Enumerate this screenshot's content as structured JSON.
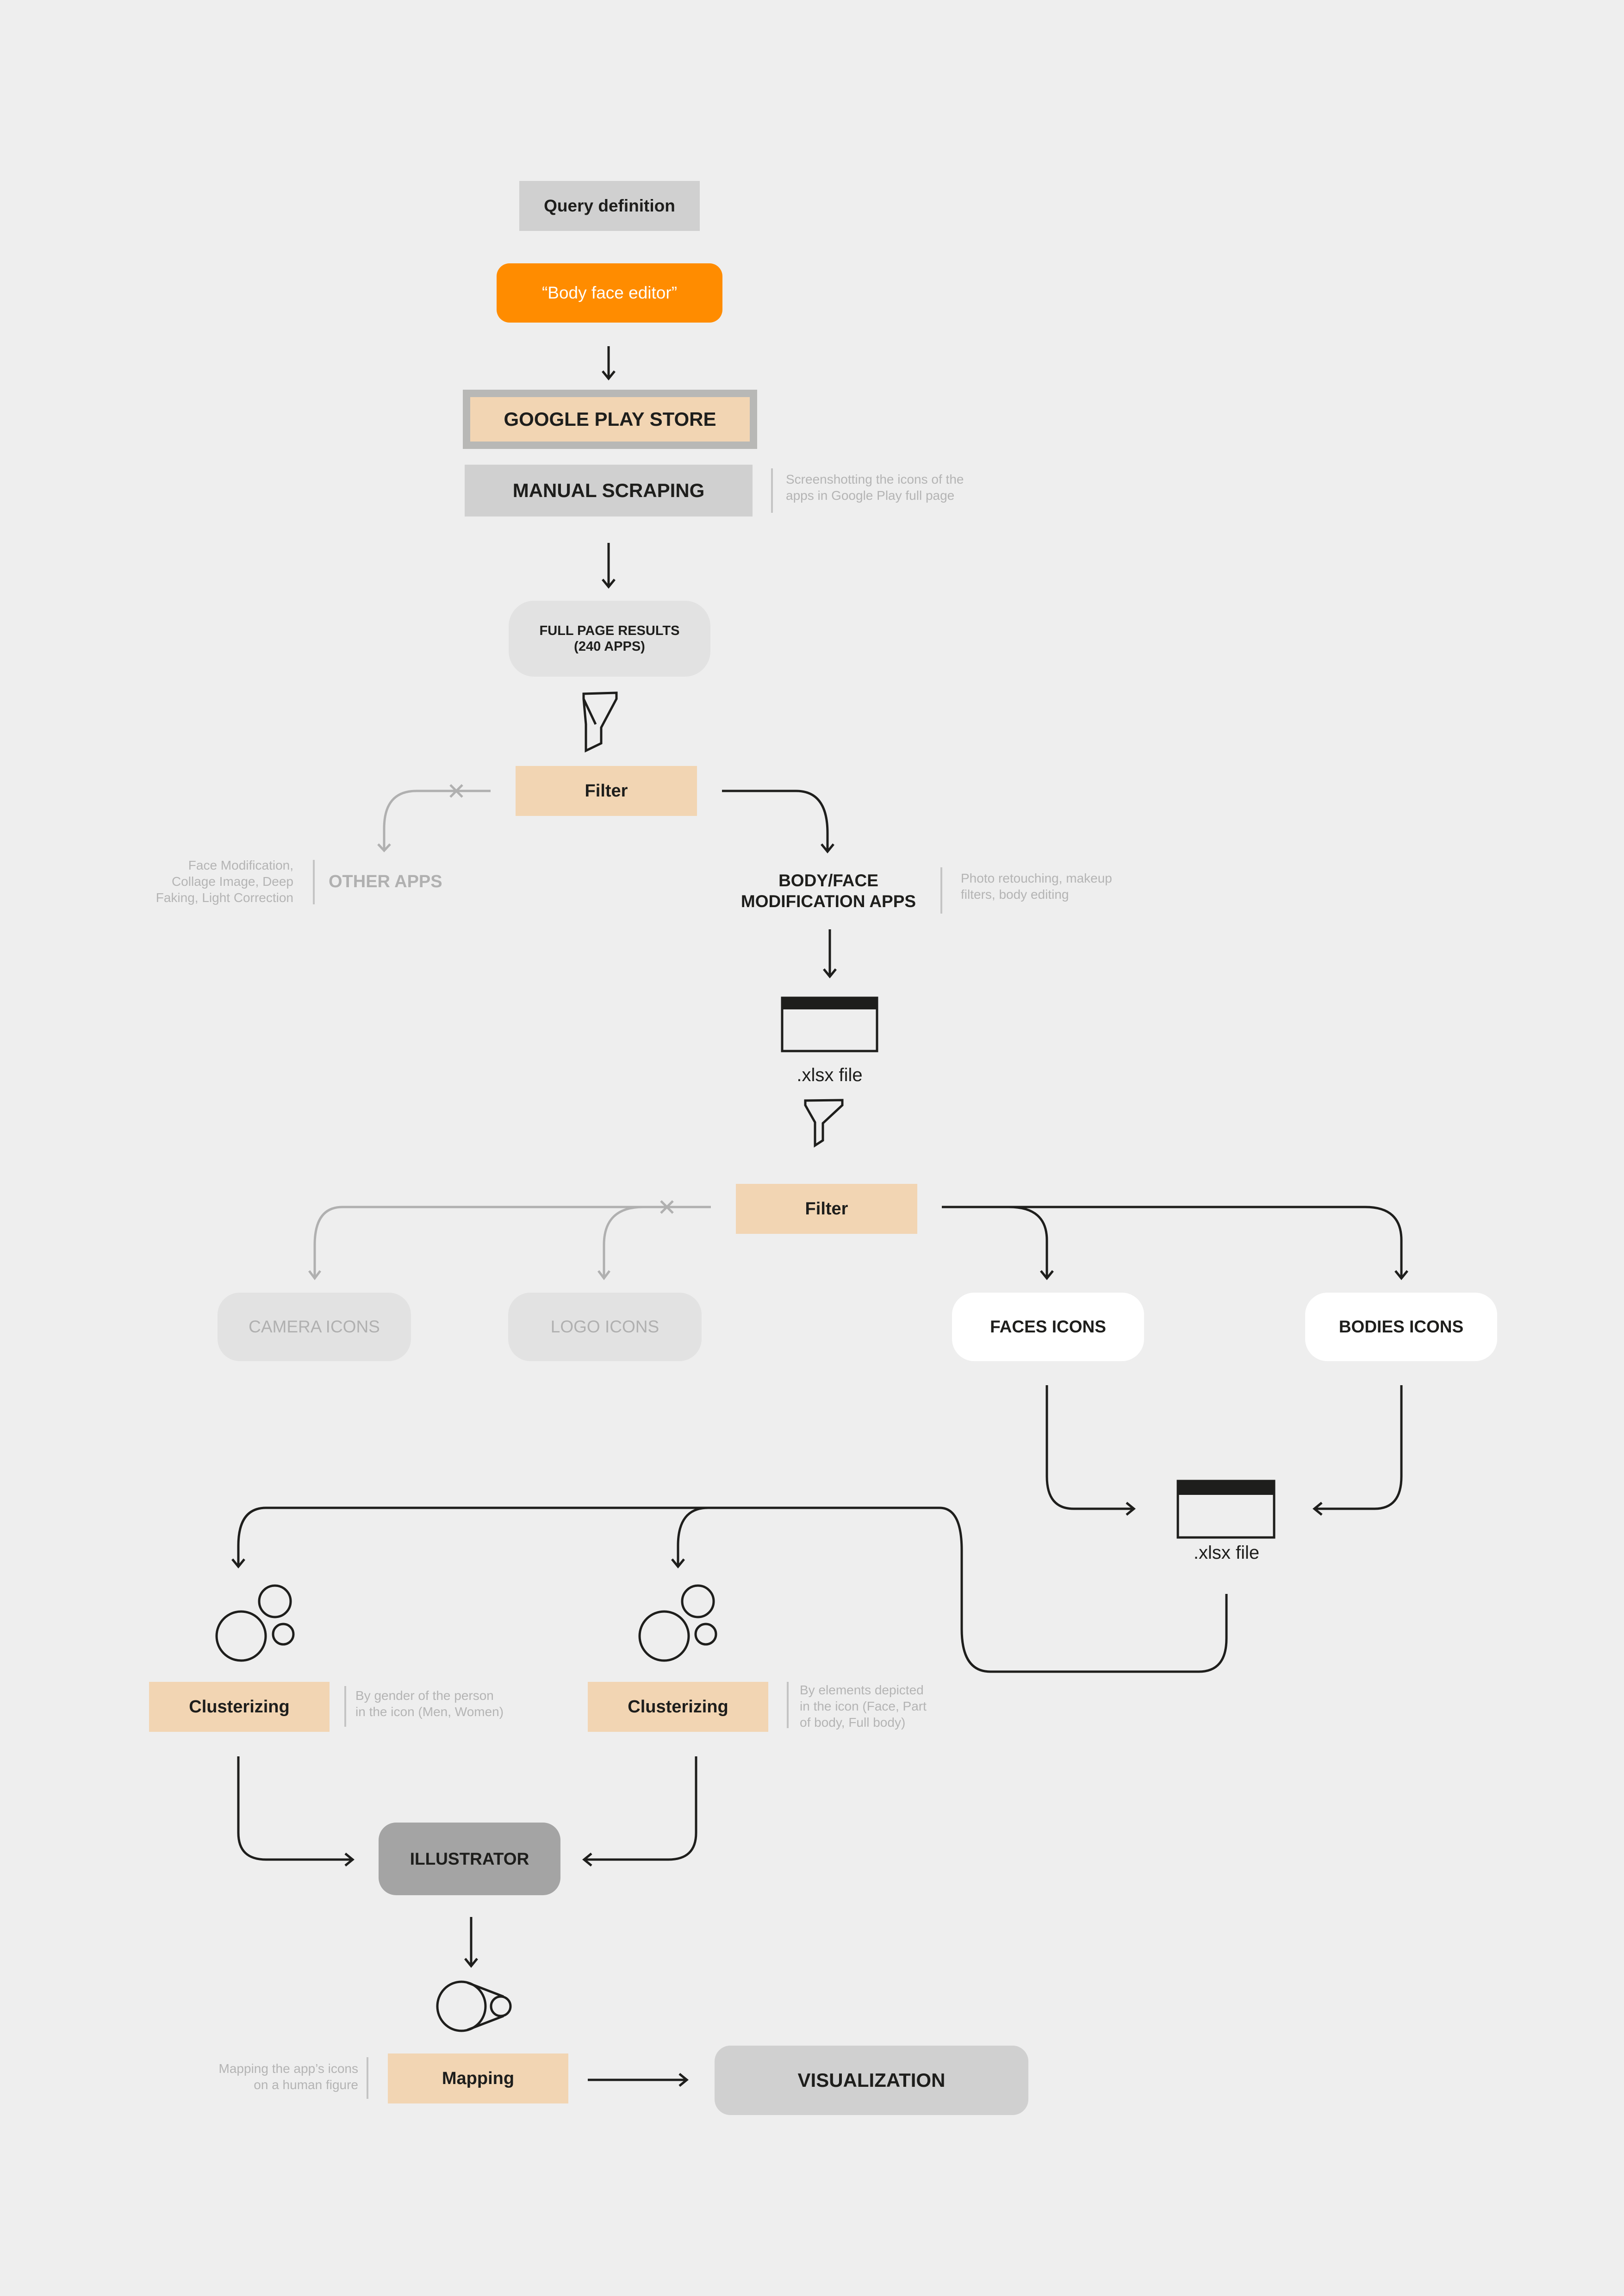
{
  "diagram": {
    "query_definition": "Query definition",
    "query_term": "“Body face editor”",
    "google_play_store": "GOOGLE PLAY STORE",
    "manual_scraping": {
      "label": "MANUAL SCRAPING",
      "note_line1": "Screenshotting the icons of the",
      "note_line2": "apps in Google Play full page"
    },
    "full_page_results": {
      "line1": "FULL PAGE RESULTS",
      "line2": "(240 APPS)"
    },
    "filter_1": "Filter",
    "other_apps": {
      "label": "OTHER APPS",
      "note_line1": "Face Modification,",
      "note_line2": "Collage Image, Deep",
      "note_line3": "Faking, Light Correction"
    },
    "body_face_apps": {
      "line1": "BODY/FACE",
      "line2": "MODIFICATION APPS",
      "note_line1": "Photo retouching, makeup",
      "note_line2": "filters, body editing"
    },
    "xlsx_file_1": ".xlsx file",
    "filter_2": "Filter",
    "camera_icons": "CAMERA ICONS",
    "logo_icons": "LOGO ICONS",
    "faces_icons": "FACES ICONS",
    "bodies_icons": "BODIES ICONS",
    "xlsx_file_2": ".xlsx file",
    "clusterizing_gender": {
      "label": "Clusterizing",
      "note_line1": "By gender of the person",
      "note_line2": "in the icon (Men, Women)"
    },
    "clusterizing_elements": {
      "label": "Clusterizing",
      "note_line1": "By elements depicted",
      "note_line2": "in the icon (Face, Part",
      "note_line3": "of body, Full body)"
    },
    "illustrator": "ILLUSTRATOR",
    "mapping": {
      "label": "Mapping",
      "note_line1": "Mapping the app’s icons",
      "note_line2": "on a human figure"
    },
    "visualization": "VISUALIZATION"
  },
  "colors": {
    "background": "#eeeeee",
    "accent_orange": "#ff8c00",
    "peach": "#f2d5b3",
    "grey_box": "#d0d0d0",
    "dark_grey_box": "#a4a4a4",
    "faded_text": "#b4b4b4",
    "ink": "#1e1e1c"
  }
}
